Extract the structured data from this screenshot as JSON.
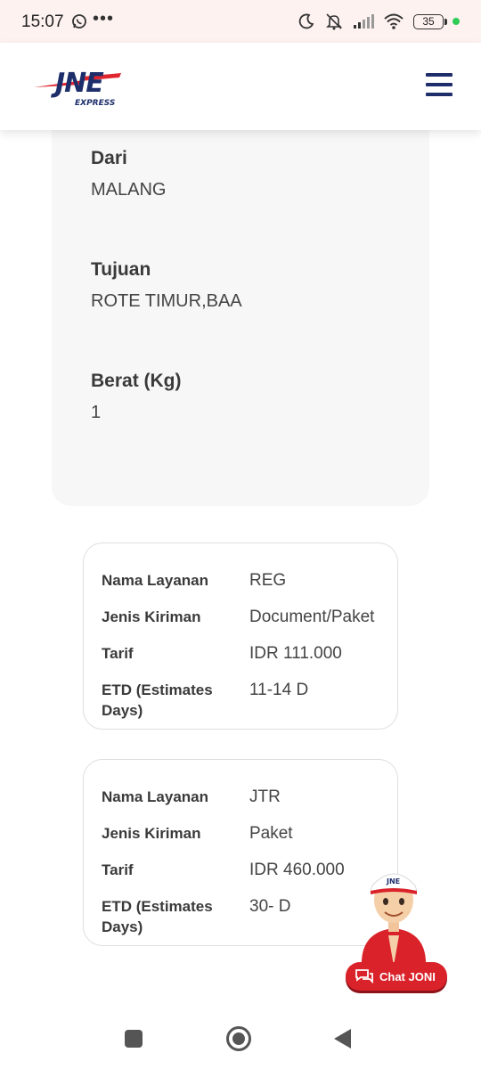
{
  "status_bar": {
    "time": "15:07",
    "battery": "35",
    "icons": [
      "whatsapp-icon",
      "more-dots-icon",
      "moon-icon",
      "mute-icon",
      "signal-icon",
      "wifi-icon",
      "battery-icon",
      "dot-indicator"
    ]
  },
  "header": {
    "logo_text": "JNE",
    "logo_subtext": "EXPRESS",
    "menu_icon": "hamburger-icon",
    "colors": {
      "brand_blue": "#1d2e6b",
      "brand_red": "#e0262f"
    }
  },
  "shipment": {
    "from_label": "Dari",
    "from_value": "MALANG",
    "to_label": "Tujuan",
    "to_value": "ROTE TIMUR,BAA",
    "weight_label": "Berat (Kg)",
    "weight_value": "1"
  },
  "services": [
    {
      "service_label": "Nama Layanan",
      "service_value": "REG",
      "type_label": "Jenis Kiriman",
      "type_value": "Document/Paket",
      "tariff_label": "Tarif",
      "tariff_value": "IDR 111.000",
      "etd_label": "ETD (Estimates Days)",
      "etd_value": "11-14 D"
    },
    {
      "service_label": "Nama Layanan",
      "service_value": "JTR",
      "type_label": "Jenis Kiriman",
      "type_value": "Paket",
      "tariff_label": "Tarif",
      "tariff_value": "IDR 460.000",
      "etd_label": "ETD (Estimates Days)",
      "etd_value": "30- D"
    }
  ],
  "chat": {
    "label": "Chat JONI",
    "cap_text": "JNE",
    "icon": "chat-bubble-icon",
    "color": "#d9222a"
  },
  "nav": {
    "icons": [
      "recents-square-icon",
      "home-circle-icon",
      "back-triangle-icon"
    ]
  }
}
